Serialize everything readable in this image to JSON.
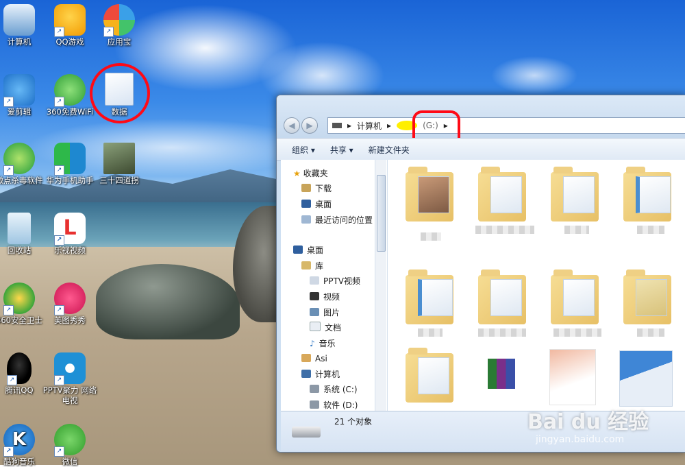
{
  "desktop": {
    "icons": [
      {
        "label": "计算机",
        "color": "#4f7fb8"
      },
      {
        "label": "QQ游戏",
        "color": "#f5b400"
      },
      {
        "label": "应用宝",
        "color": "#3aa0e8"
      },
      {
        "label": "爱剪辑",
        "color": "#2b8be0"
      },
      {
        "label": "360免费WiFi",
        "color": "#39b54a"
      },
      {
        "label": "数据",
        "color": "#ffffff"
      },
      {
        "label": "微点杀毒软件",
        "color": "#2ba84a"
      },
      {
        "label": "华为手机助手",
        "color": "#1f88d0"
      },
      {
        "label": "三十四道拐",
        "color": "#5a6b4a"
      },
      {
        "label": "回收站",
        "color": "#bcd7ee"
      },
      {
        "label": "乐视视频",
        "color": "#e8302f"
      },
      {
        "label": "360安全卫士",
        "color": "#3aa53a"
      },
      {
        "label": "美图秀秀",
        "color": "#e2226a"
      },
      {
        "label": "腾讯QQ",
        "color": "#111111"
      },
      {
        "label": "PPTV聚力 网络电视",
        "color": "#1e90d6"
      },
      {
        "label": "酷狗音乐",
        "color": "#1d7fd3"
      },
      {
        "label": "微信",
        "color": "#3cb034"
      }
    ]
  },
  "explorer": {
    "address": {
      "seg1": "计算机",
      "seg2": "(G:)"
    },
    "toolbar": {
      "organize": "组织 ▾",
      "share": "共享 ▾",
      "new_folder": "新建文件夹"
    },
    "nav": {
      "favorites": "收藏夹",
      "downloads": "下载",
      "desktop_fav": "桌面",
      "recent": "最近访问的位置",
      "desktop": "桌面",
      "libraries": "库",
      "pptv": "PPTV视频",
      "videos": "视频",
      "pictures": "图片",
      "documents": "文档",
      "music": "音乐",
      "asi": "Asi",
      "computer": "计算机",
      "drive_c": "系统 (C:)",
      "drive_d": "软件 (D:)"
    },
    "status": {
      "count": "21 个对象"
    }
  },
  "watermark": {
    "brand": "Bai du 经验",
    "url": "jingyan.baidu.com"
  }
}
